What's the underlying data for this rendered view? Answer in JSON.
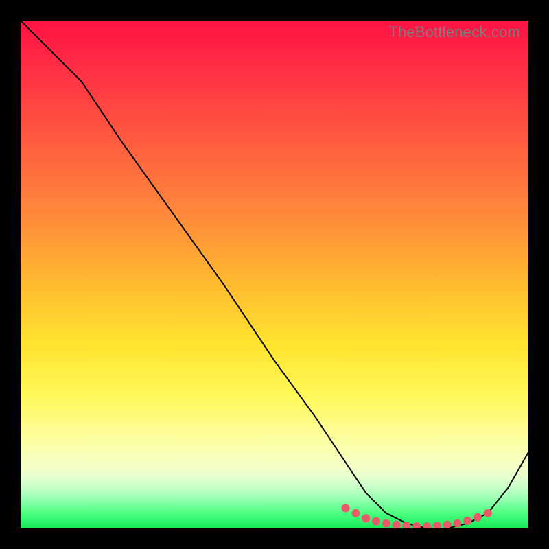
{
  "watermark": "TheBottleneck.com",
  "chart_data": {
    "type": "line",
    "title": "",
    "xlabel": "",
    "ylabel": "",
    "xlim": [
      0,
      100
    ],
    "ylim": [
      0,
      100
    ],
    "grid": false,
    "series": [
      {
        "name": "bottleneck-curve",
        "x": [
          0,
          8,
          12,
          20,
          30,
          40,
          50,
          58,
          64,
          68,
          72,
          76,
          80,
          84,
          88,
          92,
          96,
          100
        ],
        "y": [
          100,
          92,
          88,
          76,
          62,
          48,
          33,
          22,
          13,
          7,
          3,
          1,
          0,
          0,
          1,
          3,
          8,
          15
        ]
      }
    ],
    "highlight_dots": {
      "description": "pink markers along the trough of the curve",
      "x": [
        64,
        66,
        68,
        70,
        72,
        74,
        76,
        78,
        80,
        82,
        84,
        86,
        88,
        90,
        92
      ],
      "y": [
        4,
        3,
        2,
        1.4,
        1,
        0.7,
        0.5,
        0.4,
        0.4,
        0.5,
        0.7,
        1,
        1.5,
        2.2,
        3
      ]
    }
  },
  "colors": {
    "curve": "#000000",
    "dots": "#e85a6a",
    "gradient_top": "#ff1244",
    "gradient_bottom": "#15e85a",
    "watermark": "#7d7d7d",
    "frame": "#000000"
  }
}
